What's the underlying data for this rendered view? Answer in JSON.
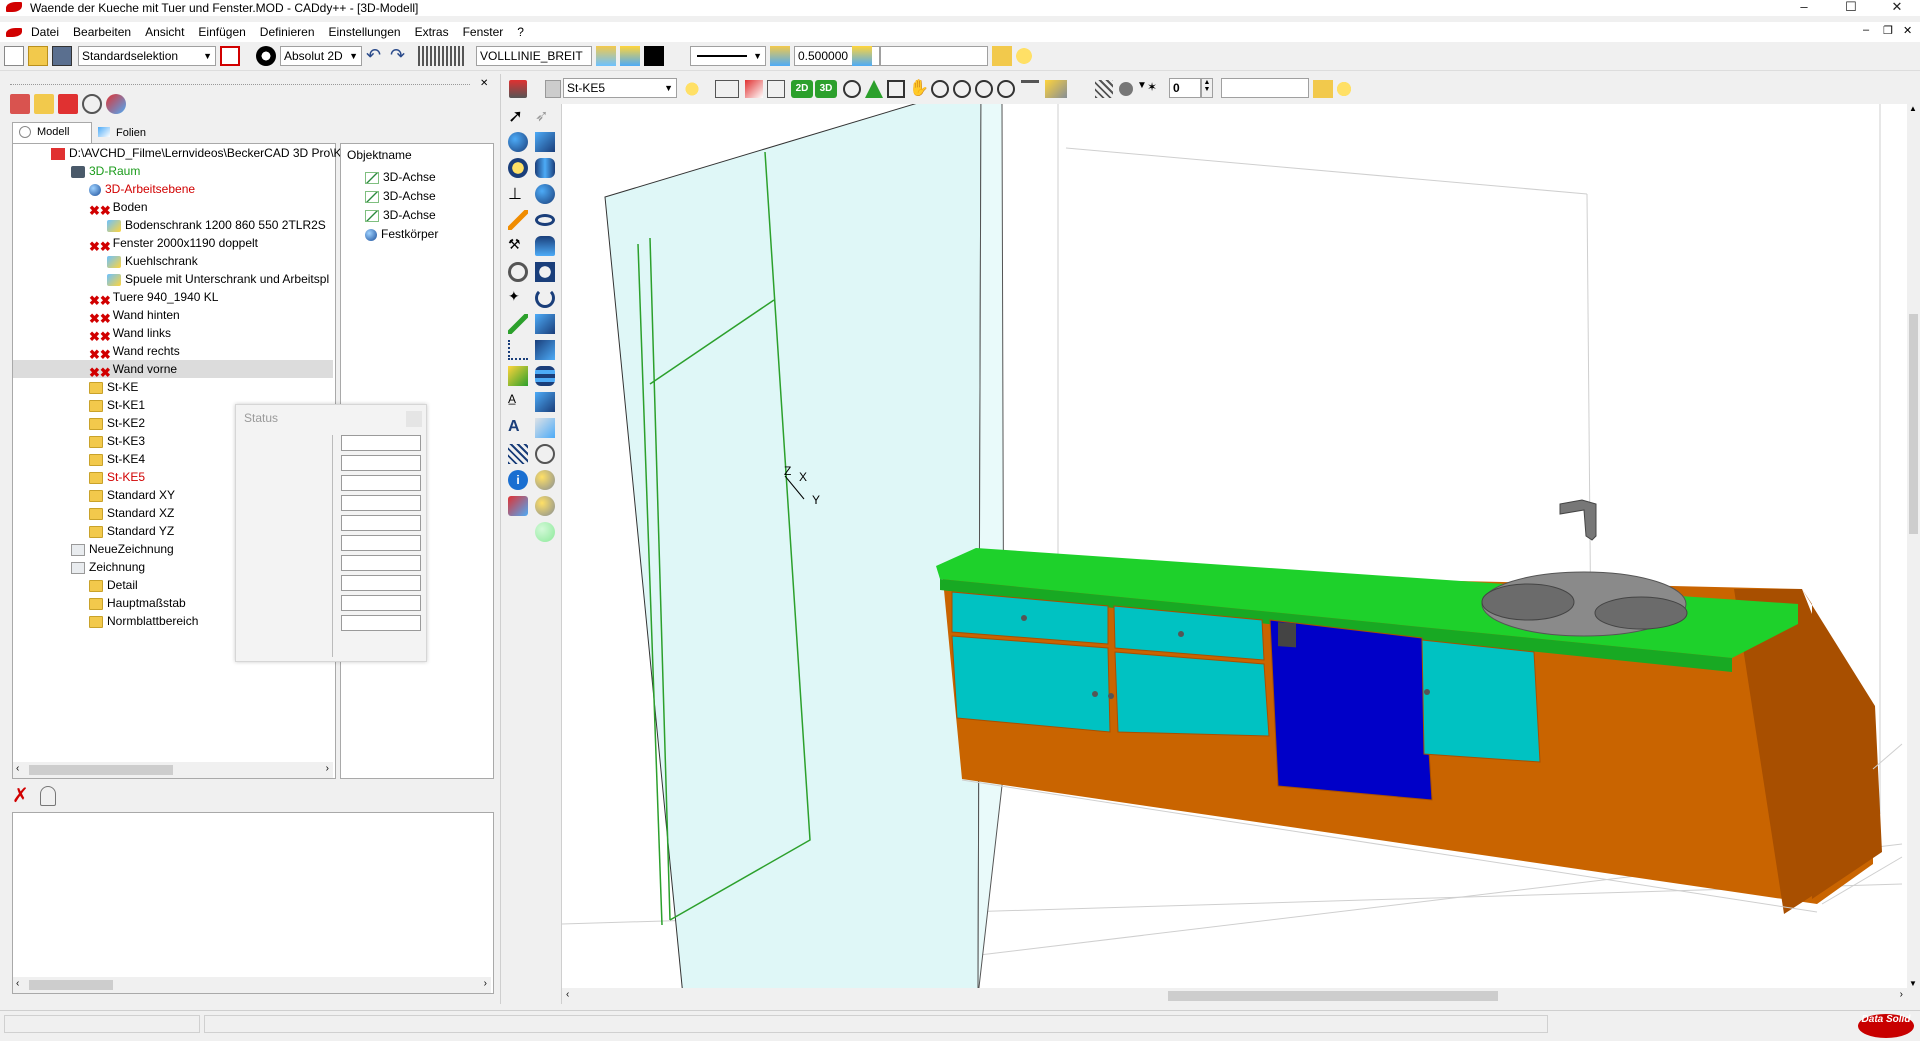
{
  "window": {
    "title": "Waende der Kueche mit Tuer und Fenster.MOD  -  CADdy++ - [3D-Modell]",
    "minimize": "–",
    "maximize": "☐",
    "close": "✕"
  },
  "menu": [
    "Datei",
    "Bearbeiten",
    "Ansicht",
    "Einfügen",
    "Definieren",
    "Einstellungen",
    "Extras",
    "Fenster",
    "?"
  ],
  "toolbar": {
    "selection_mode": "Standardselektion",
    "coord_mode": "Absolut 2D",
    "line_type_name": "VOLLLINIE_BREIT",
    "line_width": "0.500000",
    "layer_field": "",
    "current_layer": "St-KE5",
    "view_2d": "2D",
    "view_3d": "3D",
    "counter_value": "0",
    "search_field": ""
  },
  "left_tabs": [
    "Modell",
    "Folien"
  ],
  "tree": {
    "root_path": "D:\\AVCHD_Filme\\Lernvideos\\BeckerCAD 3D Pro\\K",
    "items": [
      {
        "label": "3D-Raum",
        "color": "#1a9b1a"
      },
      {
        "label": "3D-Arbeitsebene",
        "color": "#d10000"
      },
      {
        "label": "Boden",
        "color": "#000000"
      },
      {
        "label": "Bodenschrank 1200 860 550 2TLR2S",
        "color": "#000000"
      },
      {
        "label": "Fenster 2000x1190 doppelt",
        "color": "#000000"
      },
      {
        "label": "Kuehlschrank",
        "color": "#000000"
      },
      {
        "label": "Spuele mit Unterschrank und Arbeitspl",
        "color": "#000000"
      },
      {
        "label": "Tuere 940_1940 KL",
        "color": "#000000"
      },
      {
        "label": "Wand hinten",
        "color": "#000000"
      },
      {
        "label": "Wand links",
        "color": "#000000"
      },
      {
        "label": "Wand rechts",
        "color": "#000000"
      },
      {
        "label": "Wand vorne",
        "color": "#000000"
      },
      {
        "label": "St-KE",
        "color": "#000000"
      },
      {
        "label": "St-KE1",
        "color": "#000000"
      },
      {
        "label": "St-KE2",
        "color": "#000000"
      },
      {
        "label": "St-KE3",
        "color": "#000000"
      },
      {
        "label": "St-KE4",
        "color": "#000000"
      },
      {
        "label": "St-KE5",
        "color": "#d10000"
      },
      {
        "label": "Standard XY",
        "color": "#000000"
      },
      {
        "label": "Standard XZ",
        "color": "#000000"
      },
      {
        "label": "Standard YZ",
        "color": "#000000"
      },
      {
        "label": "NeueZeichnung",
        "color": "#000000"
      },
      {
        "label": "Zeichnung",
        "color": "#000000"
      },
      {
        "label": "Detail",
        "color": "#000000"
      },
      {
        "label": "Hauptmaßstab",
        "color": "#000000"
      },
      {
        "label": "Normblattbereich",
        "color": "#000000"
      }
    ]
  },
  "object_panel": {
    "header": "Objektname",
    "items": [
      "3D-Achse",
      "3D-Achse",
      "3D-Achse",
      "Festkörper"
    ]
  },
  "status_window": {
    "title": "Status"
  },
  "viewport": {
    "axis_labels": {
      "z": "Z",
      "x": "X",
      "y": "Y"
    },
    "colors": {
      "wall_glass": "#dff7f7",
      "worktop": "#1ed12b",
      "cabinet_body": "#c96400",
      "cabinet_side": "#a84f00",
      "door_cyan": "#00c2c2",
      "dishwasher_blue": "#0000c8",
      "axis_green": "#2ca02c"
    }
  },
  "logo_text": "Data Solid"
}
